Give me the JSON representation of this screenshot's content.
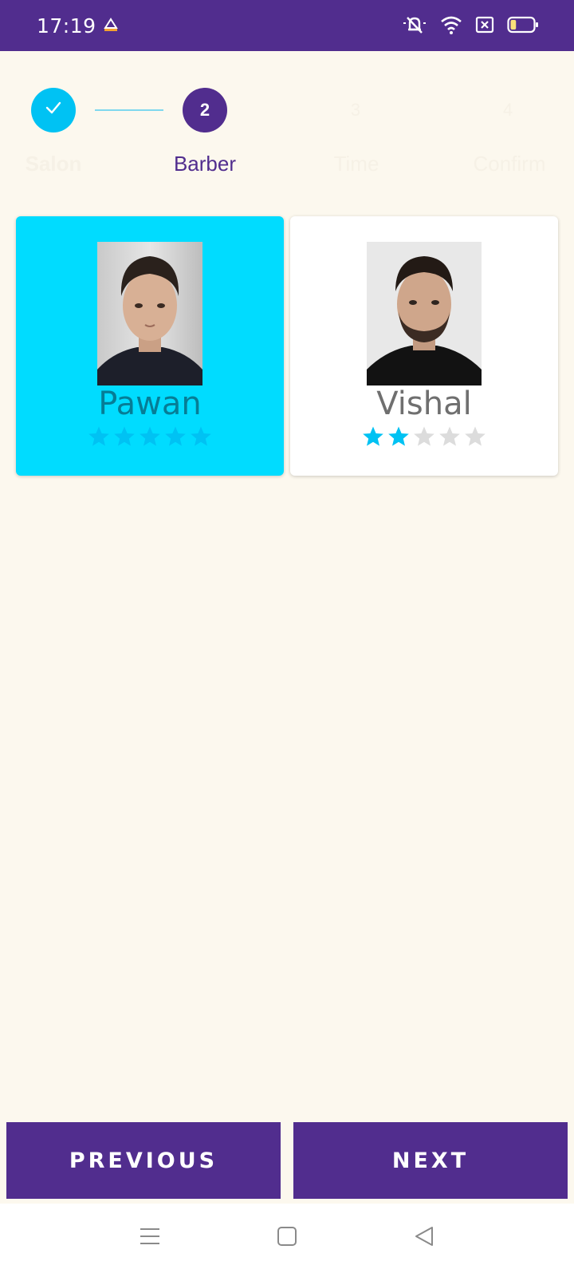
{
  "status_bar": {
    "time": "17:19",
    "icons": [
      "app-notification-icon",
      "bell-muted-icon",
      "wifi-icon",
      "sim-blocked-icon",
      "battery-icon"
    ],
    "battery_level": 0.25
  },
  "stepper": {
    "current_step": 2,
    "steps": [
      {
        "number": "1",
        "label": "Salon",
        "state": "done"
      },
      {
        "number": "2",
        "label": "Barber",
        "state": "active"
      },
      {
        "number": "3",
        "label": "Time",
        "state": "pending"
      },
      {
        "number": "4",
        "label": "Confirm",
        "state": "pending"
      }
    ]
  },
  "barbers": [
    {
      "name": "Pawan",
      "rating": 5,
      "max_rating": 5,
      "selected": true
    },
    {
      "name": "Vishal",
      "rating": 2,
      "max_rating": 5,
      "selected": false
    }
  ],
  "buttons": {
    "previous": "PREVIOUS",
    "next": "NEXT"
  },
  "colors": {
    "primary": "#512d8e",
    "accent": "#00c2f3",
    "selected_card": "#00dcff",
    "background": "#fcf8ee",
    "star_filled": "#00c2f3",
    "star_empty": "#dcdcdc"
  },
  "nav_bar": {
    "items": [
      "menu-icon",
      "home-square-icon",
      "back-triangle-icon"
    ]
  }
}
